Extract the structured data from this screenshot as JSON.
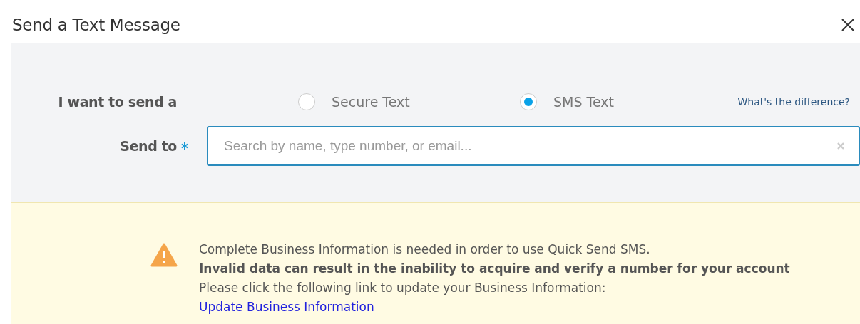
{
  "dialog": {
    "title": "Send a Text Message"
  },
  "message_type": {
    "label": "I want to send a",
    "options": [
      {
        "label": "Secure Text",
        "selected": false
      },
      {
        "label": "SMS Text",
        "selected": true
      }
    ],
    "help_link": "What's the difference?"
  },
  "send_to": {
    "label": "Send to",
    "required": true,
    "placeholder": "Search by name, type number, or email..."
  },
  "warning": {
    "lines": [
      {
        "text": "Complete Business Information is needed in order to use Quick Send SMS.",
        "bold": false
      },
      {
        "text": "Invalid data can result in the inability to acquire and verify a number for your account",
        "bold": true
      },
      {
        "text": "Please click the following link to update your Business Information:",
        "bold": false
      }
    ],
    "link": "Update Business Information"
  }
}
